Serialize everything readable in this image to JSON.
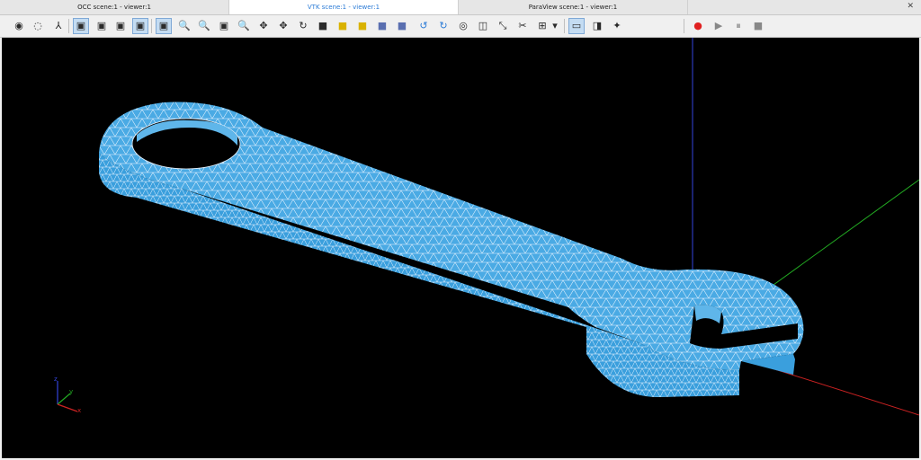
{
  "tabs": [
    {
      "label": "OCC scene:1 - viewer:1",
      "active": false
    },
    {
      "label": "VTK scene:1 - viewer:1",
      "active": true
    },
    {
      "label": "ParaView scene:1 - viewer:1",
      "active": false
    }
  ],
  "tab_close_glyph": "✕",
  "toolbar": {
    "dump_view": "◉",
    "fit_all_2": "◌",
    "trihedron": "⅄",
    "view_front": "▣",
    "view_back": "▣",
    "view_left": "▣",
    "view_right": "▣",
    "view_top": "▣",
    "view_bottom": "▣",
    "zoom": "🔍",
    "zoom_window": "🔍",
    "fit_all": "🔍",
    "pan": "✥",
    "global_pan": "✥",
    "rotate": "↻",
    "cube1": "■",
    "cube2": "■",
    "cube3": "■",
    "cube4": "■",
    "cube5": "■",
    "rotate_ccw": "↺",
    "rotate_cw": "↻",
    "graduated_axes": "◎",
    "interaction_style": "◫",
    "scale": "⤡",
    "clipping": "✂",
    "synchronize": "⊞",
    "dropdown": "▾",
    "parallel": "▭",
    "perspective": "◨",
    "render_settings": "✦",
    "record": "●",
    "play": "▶",
    "pause": "⏸",
    "stop": "■"
  },
  "colors": {
    "viewport_bg": "#000000",
    "mesh_face": "#3a9fdd",
    "mesh_face_top": "#5fb6ea",
    "mesh_edge": "#e8f4ff",
    "axis_x": "#cc2222",
    "axis_y": "#22aa22",
    "axis_z": "#3344dd",
    "active_tab_text": "#2b7bd6",
    "record": "#e02020"
  },
  "triad": {
    "x": "x",
    "y": "y",
    "z": "z"
  }
}
